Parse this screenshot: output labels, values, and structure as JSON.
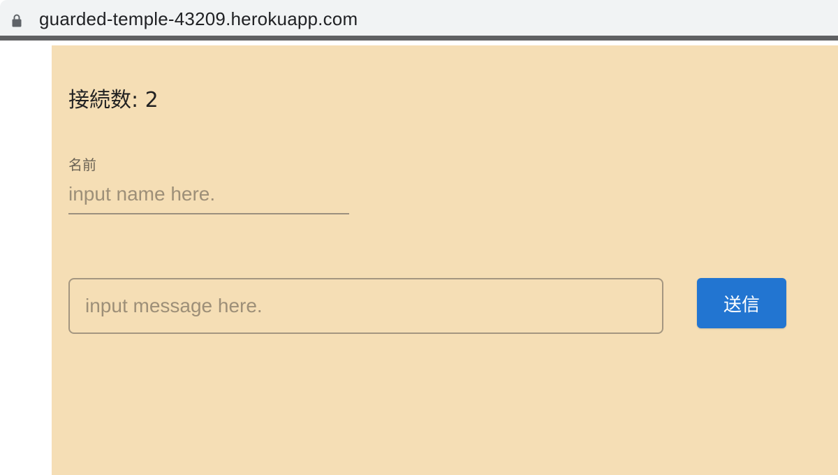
{
  "browser": {
    "url": "guarded-temple-43209.herokuapp.com",
    "lock_icon": "lock-icon"
  },
  "app": {
    "background_color": "#f5deb5",
    "connection_count": "接続数: 2",
    "name_field": {
      "label": "名前",
      "placeholder": "input name here.",
      "value": ""
    },
    "message_field": {
      "placeholder": "input message here.",
      "value": ""
    },
    "send_button": {
      "label": "送信",
      "color": "#2275d1"
    }
  }
}
